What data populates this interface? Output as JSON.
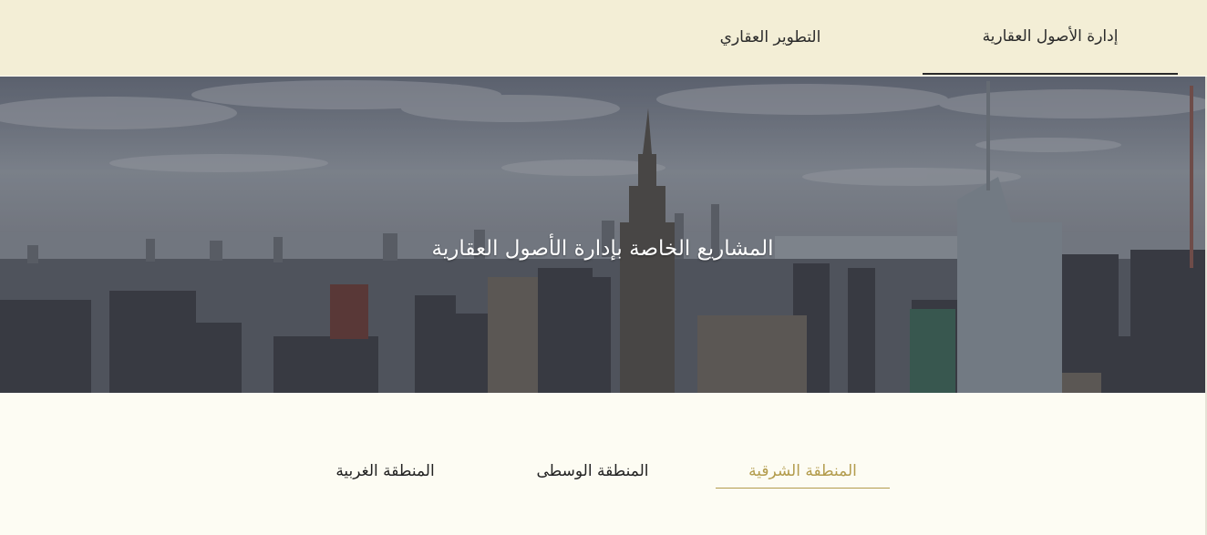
{
  "top_nav": {
    "tabs": [
      {
        "label": "إدارة الأصول العقارية",
        "active": true
      },
      {
        "label": "التطوير العقاري",
        "active": false
      }
    ]
  },
  "hero": {
    "title": "المشاريع الخاصة بإدارة الأصول العقارية"
  },
  "regions": {
    "tabs": [
      {
        "label": "المنطقة الشرقية",
        "active": true
      },
      {
        "label": "المنطقة الوسطى",
        "active": false
      },
      {
        "label": "المنطقة الغربية",
        "active": false
      }
    ]
  },
  "colors": {
    "nav_bg": "#f3eed6",
    "page_bg": "#fdfcf3",
    "accent": "#b39c4d",
    "text": "#222222"
  }
}
